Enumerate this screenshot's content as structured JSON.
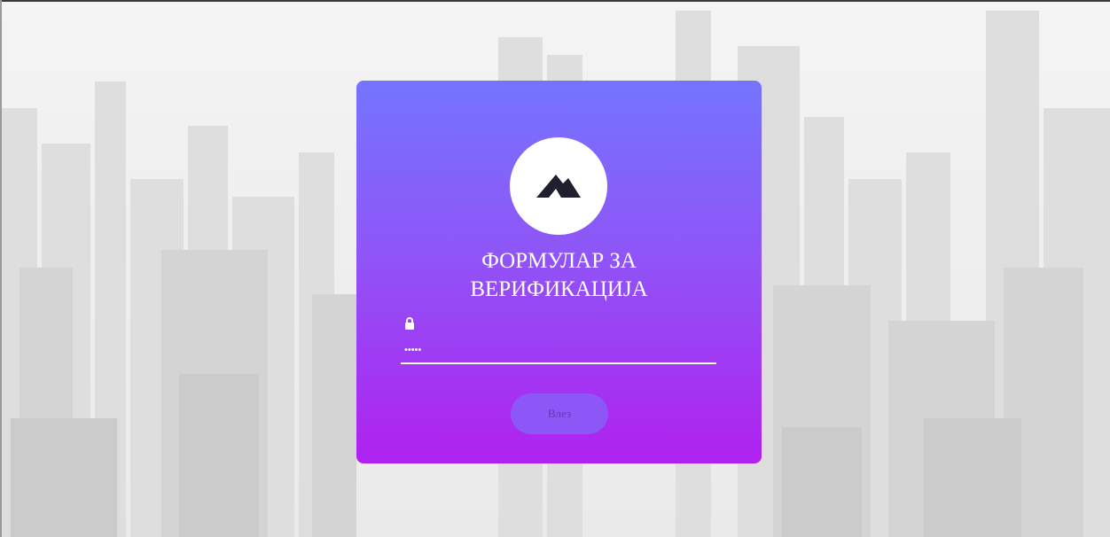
{
  "login_card": {
    "title_line1": "ФОРМУЛАР ЗА",
    "title_line2": "ВЕРИФИКАЦИЈА",
    "logo_icon": "mountain-icon",
    "password_icon": "lock-icon",
    "password_value": "12345",
    "submit_label": "Влез"
  },
  "colors": {
    "card_top": "#7574ff",
    "card_bottom": "#b021ef",
    "button": "#8d57f7",
    "text": "#ffffff"
  }
}
